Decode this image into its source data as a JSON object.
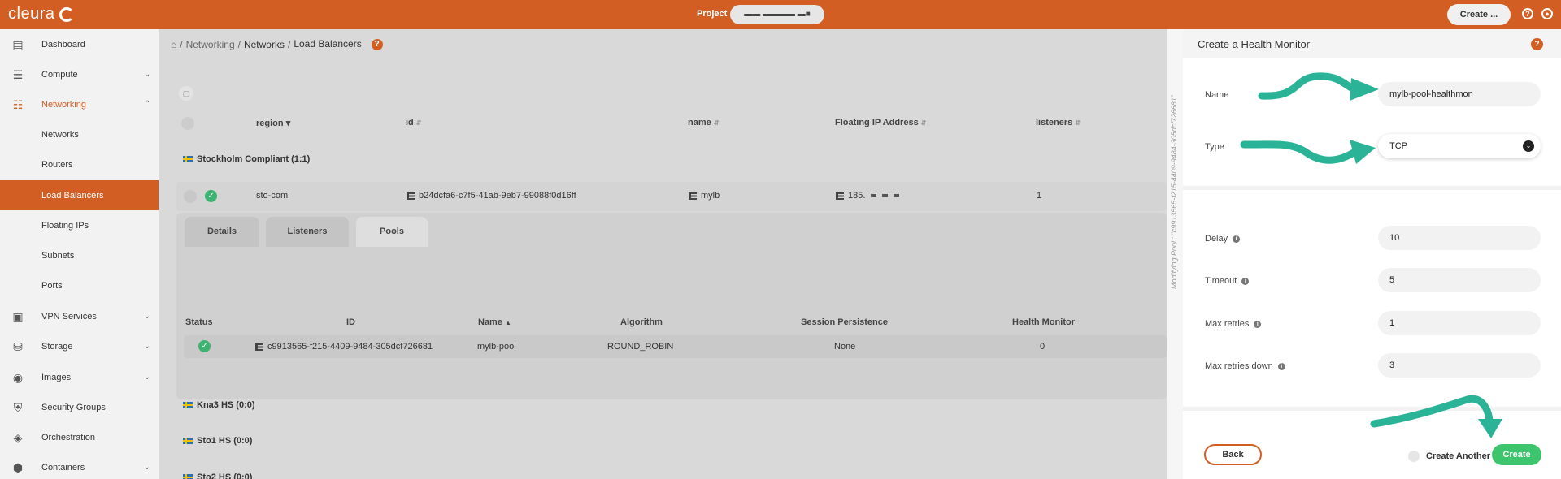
{
  "topbar": {
    "logo": "cleura",
    "project_label": "Project",
    "project_value": "▬▬  ▬▬▬▬  ▬■",
    "create_label": "Create ...",
    "help_icon": "?",
    "user_icon": "user-icon"
  },
  "sidebar": {
    "items": [
      {
        "label": "Dashboard",
        "icon": "chart-icon"
      },
      {
        "label": "Compute",
        "icon": "server-icon"
      },
      {
        "label": "Networking",
        "icon": "network-icon"
      },
      {
        "label": "Networks"
      },
      {
        "label": "Routers"
      },
      {
        "label": "Load Balancers"
      },
      {
        "label": "Floating IPs"
      },
      {
        "label": "Subnets"
      },
      {
        "label": "Ports"
      },
      {
        "label": "VPN Services",
        "icon": "lock-icon"
      },
      {
        "label": "Storage",
        "icon": "database-icon"
      },
      {
        "label": "Images",
        "icon": "camera-icon"
      },
      {
        "label": "Security Groups",
        "icon": "shield-icon"
      },
      {
        "label": "Orchestration",
        "icon": "orchestration-icon"
      },
      {
        "label": "Containers",
        "icon": "cube-icon"
      }
    ]
  },
  "breadcrumb": {
    "home": "⌂",
    "networking": "Networking",
    "networks": "Networks",
    "current": "Load Balancers",
    "sep": "/"
  },
  "table": {
    "headers": [
      "region",
      "id",
      "name",
      "Floating IP Address",
      "listeners"
    ],
    "region_groups": [
      "Stockholm Compliant (1:1)",
      "Kna3 HS (0:0)",
      "Sto1 HS (0:0)",
      "Sto2 HS (0:0)"
    ],
    "row": {
      "region": "sto-com",
      "id": "b24dcfa6-c7f5-41ab-9eb7-99088f0d16ff",
      "name": "mylb",
      "floating_ip": "185.",
      "listeners": "1"
    }
  },
  "details": {
    "tabs": [
      "Details",
      "Listeners",
      "Pools"
    ],
    "pool_headers": [
      "Status",
      "ID",
      "Name",
      "Algorithm",
      "Session Persistence",
      "Health Monitor"
    ],
    "pool_row": {
      "id": "c9913565-f215-4409-9484-305dcf726681",
      "name": "mylb-pool",
      "algorithm": "ROUND_ROBIN",
      "session_persistence": "None",
      "health_monitor": "0"
    }
  },
  "strip": {
    "text": "Modifying Pool : \"c9913565-f215-4409-9484-305dcf726681\""
  },
  "modal": {
    "title": "Create a Health Monitor",
    "name_label": "Name",
    "name_value": "mylb-pool-healthmon",
    "type_label": "Type",
    "type_value": "TCP",
    "delay_label": "Delay",
    "delay_value": "10",
    "timeout_label": "Timeout",
    "timeout_value": "5",
    "max_retries_label": "Max retries",
    "max_retries_value": "1",
    "max_retries_down_label": "Max retries down",
    "max_retries_down_value": "3",
    "back_label": "Back",
    "create_another_label": "Create Another",
    "create_label": "Create"
  },
  "colors": {
    "brand": "#d35e23",
    "success": "#3cc56d",
    "annotation": "#2bb398"
  }
}
